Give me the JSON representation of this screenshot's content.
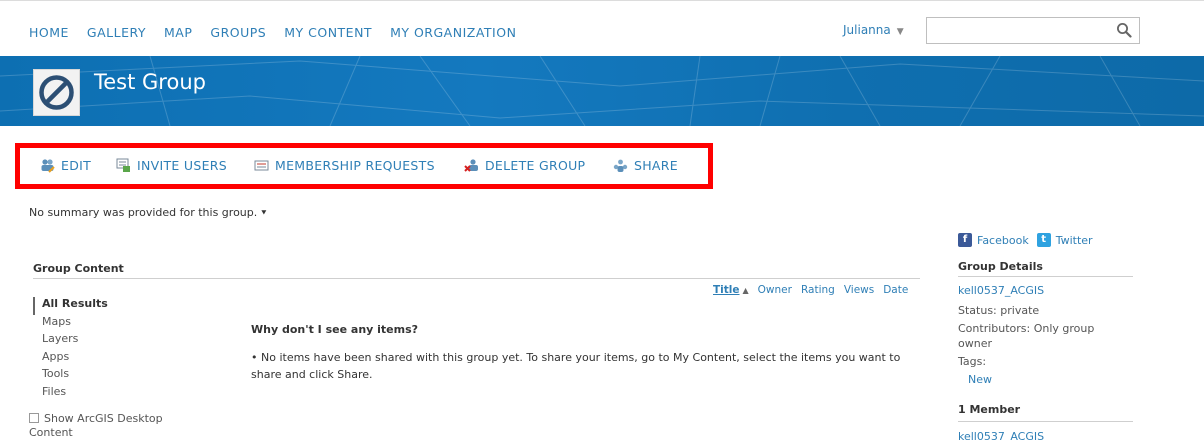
{
  "nav": {
    "links": [
      "HOME",
      "GALLERY",
      "MAP",
      "GROUPS",
      "MY CONTENT",
      "MY ORGANIZATION"
    ],
    "user": "Julianna",
    "search_value": ""
  },
  "banner": {
    "title": "Test Group"
  },
  "actions": {
    "edit": "EDIT",
    "invite": "INVITE USERS",
    "membership": "MEMBERSHIP REQUESTS",
    "delete": "DELETE GROUP",
    "share": "SHARE"
  },
  "summary": "No summary was provided for this group.",
  "content": {
    "section_title": "Group Content",
    "filters": [
      "All Results",
      "Maps",
      "Layers",
      "Apps",
      "Tools",
      "Files"
    ],
    "show_desktop": "Show ArcGIS Desktop",
    "show_desktop_2": "Content",
    "sort": {
      "title": "Title",
      "owner": "Owner",
      "rating": "Rating",
      "views": "Views",
      "date": "Date"
    },
    "why_heading": "Why don't I see any items?",
    "why_body": "No items have been shared with this group yet. To share your items, go to My Content, select the items you want to share and click Share."
  },
  "right": {
    "facebook": "Facebook",
    "twitter": "Twitter",
    "details_title": "Group Details",
    "owner": "kell0537_ACGIS",
    "status": "Status: private",
    "contributors_1": "Contributors: Only group",
    "contributors_2": "owner",
    "tags_label": "Tags:",
    "tag": "New",
    "members_title": "1 Member",
    "member": "kell0537_ACGIS"
  },
  "colors": {
    "link": "#2f7fb6",
    "banner": "#1479bf",
    "highlight": "#ff0000",
    "facebook": "#3b5998",
    "twitter": "#2fa2e0"
  }
}
